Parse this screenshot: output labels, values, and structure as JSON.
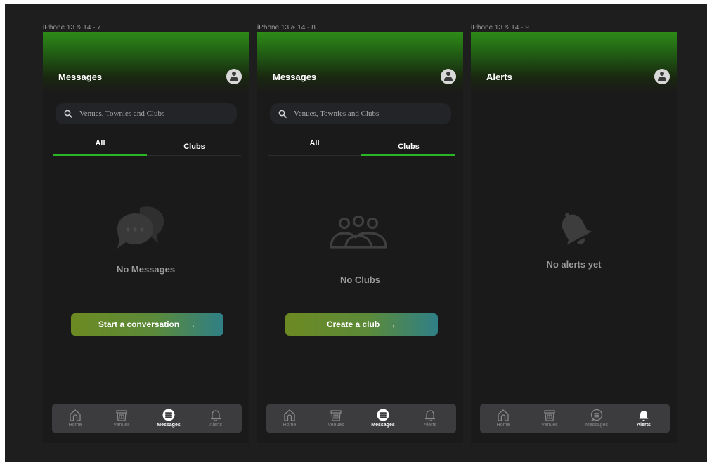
{
  "frames": [
    {
      "label": "iPhone 13 & 14 - 7",
      "title": "Messages",
      "search_placeholder": "Venues, Townies and  Clubs",
      "tabs": [
        "All",
        "Clubs"
      ],
      "active_tab": "All",
      "empty_icon": "chat-bubbles-icon",
      "empty_text": "No Messages",
      "cta_label": "Start a conversation",
      "active_nav": "Messages"
    },
    {
      "label": "iPhone 13 & 14 - 8",
      "title": "Messages",
      "search_placeholder": "Venues, Townies and  Clubs",
      "tabs": [
        "All",
        "Clubs"
      ],
      "active_tab": "Clubs",
      "empty_icon": "group-icon",
      "empty_text": "No Clubs",
      "cta_label": "Create a club",
      "active_nav": "Messages"
    },
    {
      "label": "iPhone 13 & 14 - 9",
      "title": "Alerts",
      "empty_icon": "bell-icon",
      "empty_text": "No alerts yet",
      "active_nav": "Alerts"
    }
  ],
  "nav": {
    "home": "Home",
    "venues": "Venues",
    "messages": "Messages",
    "alerts": "Alerts"
  },
  "colors": {
    "accent_green": "#2bb526",
    "background": "#1a1a1a",
    "canvas": "#1e1e1e",
    "nav_bar": "#3c3c3e"
  }
}
